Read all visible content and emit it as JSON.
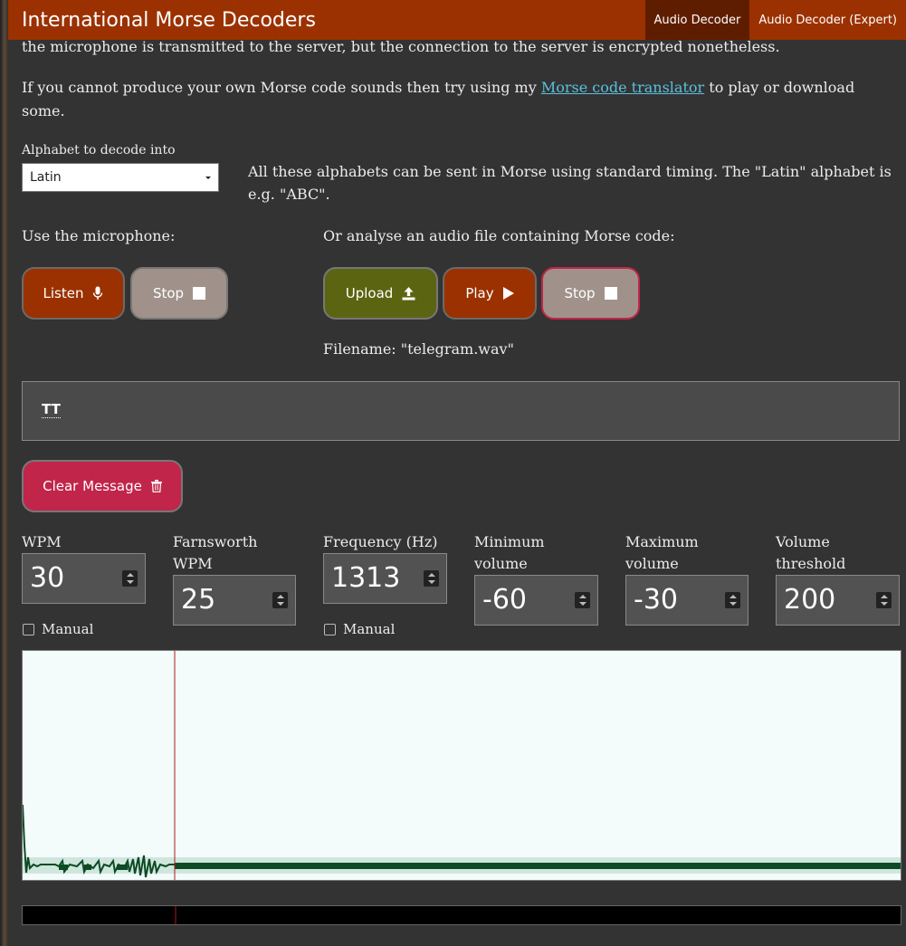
{
  "header": {
    "title": "International Morse Decoders",
    "tabs": [
      {
        "label": "Audio Decoder",
        "active": true
      },
      {
        "label": "Audio Decoder (Expert)",
        "active": false
      }
    ]
  },
  "intro": {
    "privacy_text": "the microphone is transmitted to the server, but the connection to the server is encrypted nonetheless.",
    "translator_before": "If you cannot produce your own Morse code sounds then try using my ",
    "translator_link": "Morse code translator",
    "translator_after": " to play or download some."
  },
  "alphabet": {
    "label": "Alphabet to decode into",
    "selected": "Latin",
    "note": "All these alphabets can be sent in Morse using standard timing. The \"Latin\" alphabet is e.g. \"ABC\"."
  },
  "microphone": {
    "label": "Use the microphone:",
    "listen_label": "Listen",
    "stop_label": "Stop"
  },
  "file": {
    "label": "Or analyse an audio file containing Morse code:",
    "upload_label": "Upload",
    "play_label": "Play",
    "stop_label": "Stop",
    "filename_text": "Filename: \"telegram.wav\""
  },
  "message": {
    "text": "TT",
    "clear_label": "Clear Message"
  },
  "settings": {
    "wpm": {
      "label": "WPM",
      "value": "30",
      "manual_label": "Manual",
      "manual_checked": false
    },
    "farnsworth": {
      "label_line1": "Farnsworth",
      "label_line2": "WPM",
      "value": "25"
    },
    "frequency": {
      "label": "Frequency (Hz)",
      "value": "1313",
      "manual_label": "Manual",
      "manual_checked": false
    },
    "min_volume": {
      "label_line1": "Minimum",
      "label_line2": "volume",
      "value": "-60"
    },
    "max_volume": {
      "label_line1": "Maximum",
      "label_line2": "volume",
      "value": "-30"
    },
    "threshold": {
      "label_line1": "Volume",
      "label_line2": "threshold",
      "value": "200"
    }
  },
  "colors": {
    "header": "#9b3100",
    "tab_active": "#5f1d00",
    "button_orange": "#9b3100",
    "button_grey": "#a0928a",
    "button_olive": "#5b6410",
    "button_clear": "#c1254a",
    "scope_background": "#f4fbfb",
    "signal": "#0d4a25",
    "playhead": "#b01818"
  }
}
